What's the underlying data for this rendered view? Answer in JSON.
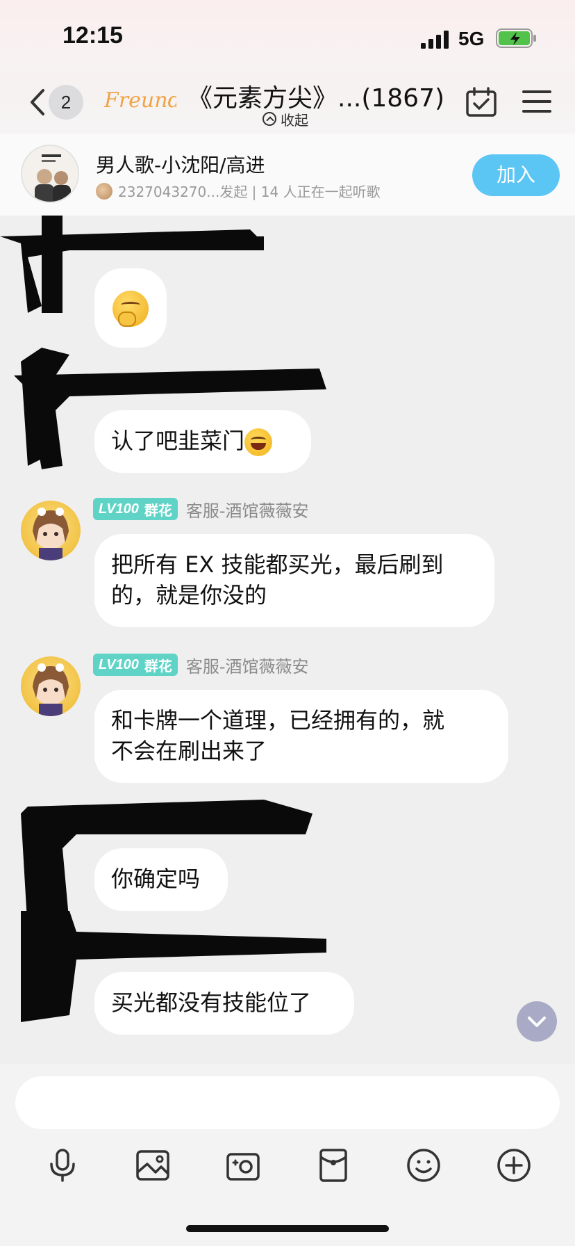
{
  "status_bar": {
    "time": "12:15",
    "network": "5G",
    "icons": [
      "signal-icon",
      "battery-charging-icon"
    ]
  },
  "header": {
    "unread_count": "2",
    "logo_text": "Freunde",
    "title": "《元素方尖》...(1867)",
    "collapse_label": "收起",
    "icons": [
      "back-icon",
      "checkin-calendar-icon",
      "menu-icon"
    ]
  },
  "listen_bar": {
    "song": "男人歌-小沈阳/高进",
    "meta": "2327043270...发起 | 14 人正在一起听歌",
    "join_label": "加入"
  },
  "messages": [
    {
      "sender": "",
      "redacted": true,
      "emoji": "hushed-face"
    },
    {
      "sender": "",
      "redacted": true,
      "text": "认了吧韭菜门",
      "emoji": "grinning-squint-face"
    },
    {
      "sender": "客服-酒馆薇薇安",
      "level": "LV100",
      "role": "群花",
      "lines": [
        "把所有 EX 技能都买光，最后刷到",
        "的，就是你没的"
      ]
    },
    {
      "sender": "客服-酒馆薇薇安",
      "level": "LV100",
      "role": "群花",
      "lines": [
        "和卡牌一个道理，已经拥有的，就",
        "不会在刷出来了"
      ]
    },
    {
      "sender": "",
      "redacted": true,
      "text": "你确定吗"
    },
    {
      "sender": "",
      "redacted": true,
      "text": "买光都没有技能位了"
    }
  ],
  "input": {
    "placeholder": "",
    "toolbar_icons": [
      "microphone-icon",
      "image-icon",
      "camera-icon",
      "red-packet-icon",
      "emoji-icon",
      "plus-icon"
    ]
  },
  "colors": {
    "accent": "#5bc5f3",
    "level_badge": "#5fd3c6",
    "background": "#efefef",
    "bubble": "#ffffff"
  }
}
